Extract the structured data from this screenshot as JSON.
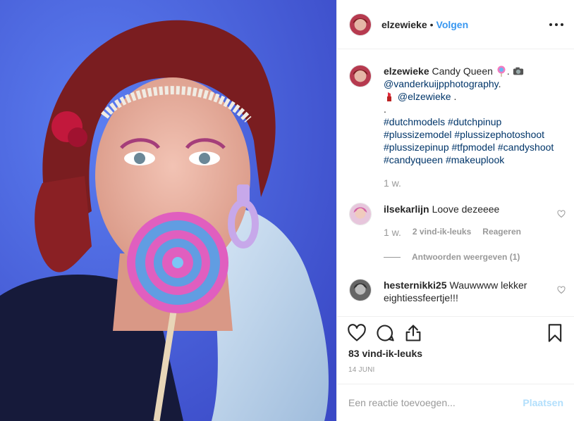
{
  "header": {
    "username": "elzewieke",
    "separator": "•",
    "follow_label": "Volgen"
  },
  "caption": {
    "username": "elzewieke",
    "text_line1": "Candy Queen",
    "text_line1_after": ".",
    "mention_photographer": "@vanderkuijpphotography",
    "line2_tail": ".",
    "mention_makeup": "@elzewieke",
    "line3_tail": ".",
    "line4": ".",
    "hashtag_line1": "#dutchmodels #dutchpinup",
    "hashtag_line2": "#plussizemodel #plussizephotoshoot",
    "hashtag_line3": "#plussizepinup #tfpmodel #candyshoot",
    "hashtag_line4": "#candyqueen #makeuplook",
    "time": "1 w."
  },
  "comments": [
    {
      "username": "ilsekarlijn",
      "text": "Loove dezeeee",
      "time": "1 w.",
      "likes": "2 vind-ik-leuks",
      "reply_label": "Reageren",
      "view_replies": "Antwoorden weergeven (1)"
    },
    {
      "username": "hesternikki25",
      "text": "Wauwwww lekker eightiessfeertje!!!"
    }
  ],
  "actions": {
    "likes": "83 vind-ik-leuks",
    "date": "14 JUNI"
  },
  "add_comment": {
    "placeholder": "Een reactie toevoegen...",
    "post_label": "Plaatsen"
  },
  "icons": {
    "more": "more-options-icon",
    "like": "heart-icon",
    "comment": "comment-bubble-icon",
    "share": "share-icon",
    "save": "bookmark-icon"
  },
  "colors": {
    "link_blue": "#3897f0",
    "hashtag_blue": "#003569",
    "muted_gray": "#999999",
    "disabled_blue": "#b2dffc"
  }
}
